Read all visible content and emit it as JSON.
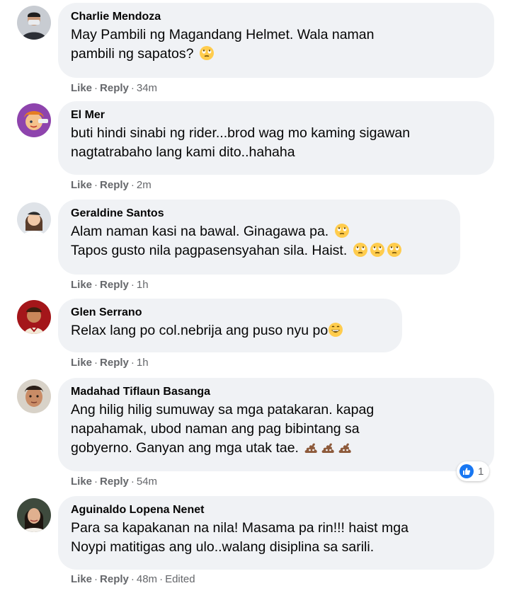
{
  "actions": {
    "like_label": "Like",
    "reply_label": "Reply"
  },
  "comments": [
    {
      "author": "Charlie Mendoza",
      "lines": [
        "May Pambili ng Magandang Helmet. Wala naman",
        "pambili ng sapatos?"
      ],
      "emoji_line2": [
        "face-with-rolling-eyes"
      ],
      "time": "34m"
    },
    {
      "author": "El Mer",
      "lines": [
        "buti hindi sinabi ng rider...brod wag mo kaming sigawan",
        "nagtatrabaho lang kami dito..hahaha"
      ],
      "time": "2m"
    },
    {
      "author": "Geraldine Santos",
      "lines": [
        "Alam naman kasi na bawal. Ginagawa pa.",
        "Tapos gusto nila pagpasensyahan sila. Haist."
      ],
      "emoji_line1": [
        "face-with-rolling-eyes"
      ],
      "emoji_line2": [
        "face-with-rolling-eyes",
        "face-with-rolling-eyes",
        "face-with-rolling-eyes"
      ],
      "time": "1h"
    },
    {
      "author": "Glen Serrano",
      "lines": [
        "Relax lang po col.nebrija ang puso nyu po"
      ],
      "emoji_line1": [
        "grinning-face"
      ],
      "time": "1h"
    },
    {
      "author": "Madahad Tiflaun Basanga",
      "lines": [
        "Ang hilig hilig sumuway sa mga patakaran. kapag",
        "napahamak, ubod naman ang pag bibintang sa",
        "gobyerno. Ganyan ang mga utak tae."
      ],
      "emoji_line3": [
        "pile-of-poo",
        "pile-of-poo",
        "pile-of-poo"
      ],
      "time": "54m",
      "reaction": {
        "icon": "like-icon",
        "count": "1"
      }
    },
    {
      "author": "Aguinaldo Lopena Nenet",
      "lines": [
        "Para sa kapakanan na nila! Masama pa rin!!! haist mga",
        "Noypi matitigas ang ulo..walang disiplina sa sarili."
      ],
      "time": "48m",
      "edited": "Edited"
    }
  ],
  "colors": {
    "bubble": "#f0f2f5",
    "meta_text": "#65676b",
    "like_blue": "#1877f2"
  }
}
